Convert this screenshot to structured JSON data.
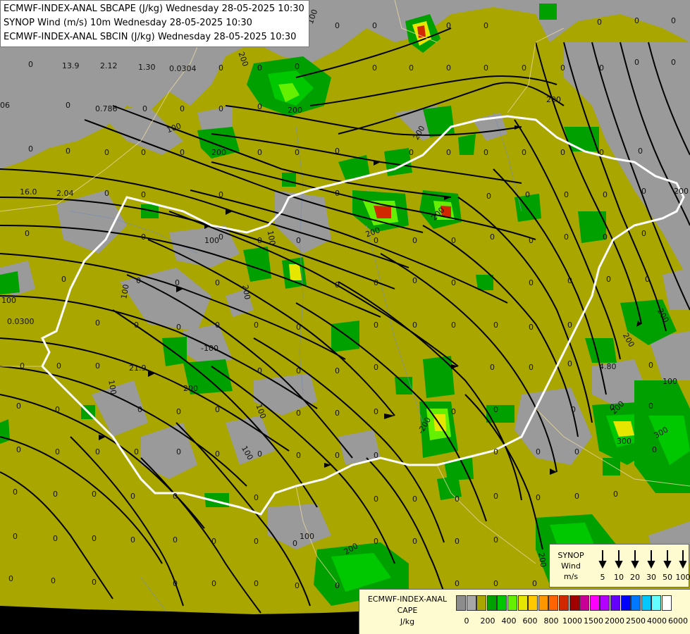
{
  "title_lines": [
    "ECMWF-INDEX-ANAL SBCAPE (J/kg) Wednesday 28-05-2025 10:30",
    "SYNOP Wind (m/s) 10m Wednesday 28-05-2025 10:30",
    "ECMWF-INDEX-ANAL SBCIN (J/kg) Wednesday 28-05-2025 10:30"
  ],
  "synop_legend": {
    "label_lines": [
      "SYNOP",
      "Wind",
      "m/s"
    ],
    "values": [
      "5",
      "10",
      "20",
      "30",
      "50",
      "100"
    ]
  },
  "cape_legend": {
    "label_lines": [
      "ECMWF-INDEX-ANAL",
      "CAPE",
      "J/kg"
    ],
    "colors": [
      "#8c8c8c",
      "#a7a7a7",
      "#a9a600",
      "#00a000",
      "#00c800",
      "#64f000",
      "#e6e600",
      "#ffc800",
      "#ff9600",
      "#ff6400",
      "#d22800",
      "#a00000",
      "#c80096",
      "#ff00ff",
      "#b400ff",
      "#6400ff",
      "#0000ff",
      "#0078ff",
      "#00c8ff",
      "#64ffff",
      "#ffffff"
    ],
    "tick_labels": [
      "0",
      "200",
      "400",
      "600",
      "800",
      "1000",
      "1500",
      "2000",
      "2500",
      "4000",
      "6000"
    ]
  },
  "map": {
    "colors": {
      "background": "#a9a600",
      "no_cape": "#9a9a9a",
      "low": "#00a000",
      "mid": "#00c800",
      "high": "#64f000",
      "core_yellow": "#e6e600",
      "core_red": "#d22800",
      "border": "#ffffff",
      "sea": "#000000"
    },
    "value_labels": [
      "0",
      "13.9",
      "2.12",
      "1.30",
      "0.0304",
      "0.786",
      "16.0",
      "2.04",
      "0.0300",
      "21.9",
      "4.80",
      "06"
    ],
    "contour_labels": [
      "200",
      "100",
      "300",
      "-100",
      "-200"
    ]
  }
}
